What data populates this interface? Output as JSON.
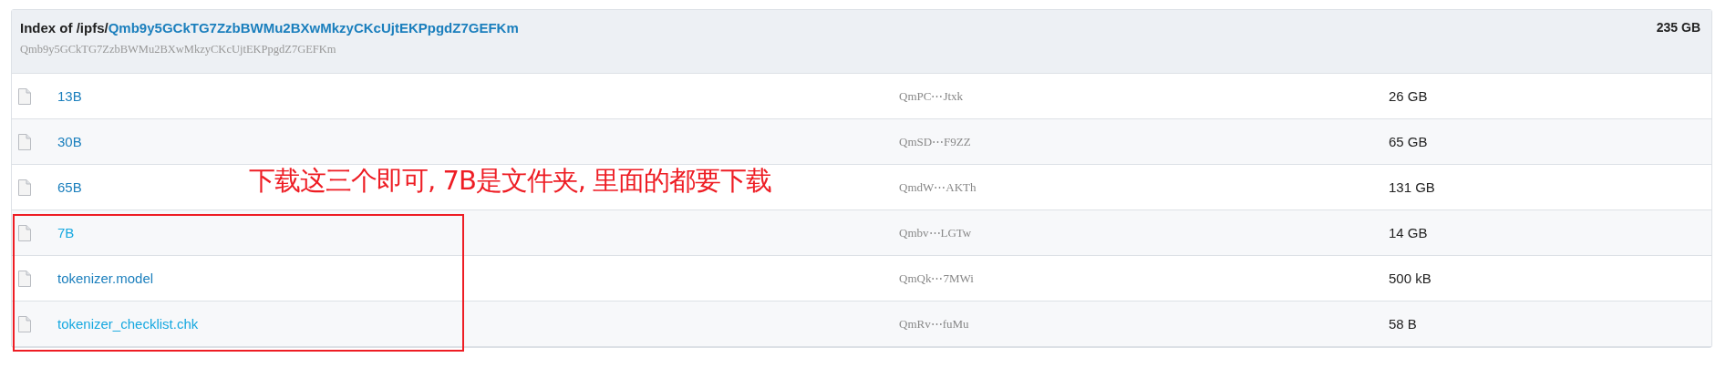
{
  "header": {
    "title_prefix": "Index of /ipfs/",
    "title_link": "Qmb9y5GCkTG7ZzbBWMu2BXwMkzyCKcUjtEKPpgdZ7GEFKm",
    "hash": "Qmb9y5GCkTG7ZzbBWMu2BXwMkzyCKcUjtEKPpgdZ7GEFKm",
    "total_size": "235 GB"
  },
  "rows": [
    {
      "name": "13B",
      "visited": true,
      "hash": "QmPC⋯Jtxk",
      "size": "26 GB"
    },
    {
      "name": "30B",
      "visited": true,
      "hash": "QmSD⋯F9ZZ",
      "size": "65 GB"
    },
    {
      "name": "65B",
      "visited": true,
      "hash": "QmdW⋯AKTh",
      "size": "131 GB"
    },
    {
      "name": "7B",
      "visited": false,
      "hash": "Qmbv⋯LGTw",
      "size": "14 GB"
    },
    {
      "name": "tokenizer.model",
      "visited": true,
      "hash": "QmQk⋯7MWi",
      "size": "500 kB"
    },
    {
      "name": "tokenizer_checklist.chk",
      "visited": false,
      "hash": "QmRv⋯fuMu",
      "size": "58 B"
    }
  ],
  "annotation": {
    "text": "下载这三个即可, 7B是文件夹, 里面的都要下载"
  }
}
